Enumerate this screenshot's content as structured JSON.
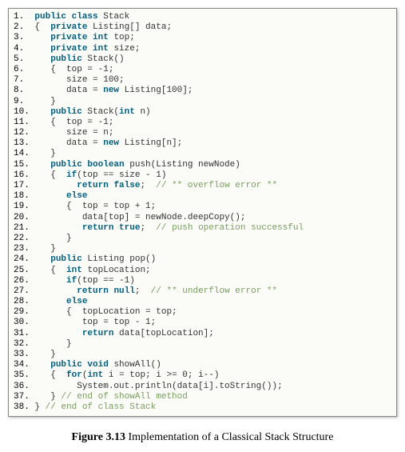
{
  "caption": {
    "label": "Figure 3.13",
    "text": " Implementation of a Classical Stack Structure"
  },
  "code": [
    {
      "n": "1.",
      "segs": [
        {
          "t": "  ",
          "c": "plain"
        },
        {
          "t": "public class",
          "c": "kw"
        },
        {
          "t": " Stack",
          "c": "plain"
        }
      ]
    },
    {
      "n": "2.",
      "segs": [
        {
          "t": "  {  ",
          "c": "plain"
        },
        {
          "t": "private",
          "c": "kw"
        },
        {
          "t": " Listing[] data;",
          "c": "plain"
        }
      ]
    },
    {
      "n": "3.",
      "segs": [
        {
          "t": "     ",
          "c": "plain"
        },
        {
          "t": "private int",
          "c": "kw"
        },
        {
          "t": " top;",
          "c": "plain"
        }
      ]
    },
    {
      "n": "4.",
      "segs": [
        {
          "t": "     ",
          "c": "plain"
        },
        {
          "t": "private int",
          "c": "kw"
        },
        {
          "t": " size;",
          "c": "plain"
        }
      ]
    },
    {
      "n": "5.",
      "segs": [
        {
          "t": "     ",
          "c": "plain"
        },
        {
          "t": "public",
          "c": "kw"
        },
        {
          "t": " Stack()",
          "c": "plain"
        }
      ]
    },
    {
      "n": "6.",
      "segs": [
        {
          "t": "     {  top = -1;",
          "c": "plain"
        }
      ]
    },
    {
      "n": "7.",
      "segs": [
        {
          "t": "        size = 100;",
          "c": "plain"
        }
      ]
    },
    {
      "n": "8.",
      "segs": [
        {
          "t": "        data = ",
          "c": "plain"
        },
        {
          "t": "new",
          "c": "kw"
        },
        {
          "t": " Listing[100];",
          "c": "plain"
        }
      ]
    },
    {
      "n": "9.",
      "segs": [
        {
          "t": "     }",
          "c": "plain"
        }
      ]
    },
    {
      "n": "10.",
      "segs": [
        {
          "t": "    ",
          "c": "plain"
        },
        {
          "t": "public",
          "c": "kw"
        },
        {
          "t": " Stack(",
          "c": "plain"
        },
        {
          "t": "int",
          "c": "kw"
        },
        {
          "t": " n)",
          "c": "plain"
        }
      ]
    },
    {
      "n": "11.",
      "segs": [
        {
          "t": "    {  top = -1;",
          "c": "plain"
        }
      ]
    },
    {
      "n": "12.",
      "segs": [
        {
          "t": "       size = n;",
          "c": "plain"
        }
      ]
    },
    {
      "n": "13.",
      "segs": [
        {
          "t": "       data = ",
          "c": "plain"
        },
        {
          "t": "new",
          "c": "kw"
        },
        {
          "t": " Listing[n];",
          "c": "plain"
        }
      ]
    },
    {
      "n": "14.",
      "segs": [
        {
          "t": "    }",
          "c": "plain"
        }
      ]
    },
    {
      "n": "15.",
      "segs": [
        {
          "t": "    ",
          "c": "plain"
        },
        {
          "t": "public boolean",
          "c": "kw"
        },
        {
          "t": " push(Listing newNode)",
          "c": "plain"
        }
      ]
    },
    {
      "n": "16.",
      "segs": [
        {
          "t": "    {  ",
          "c": "plain"
        },
        {
          "t": "if",
          "c": "kw"
        },
        {
          "t": "(top == size - 1)",
          "c": "plain"
        }
      ]
    },
    {
      "n": "17.",
      "segs": [
        {
          "t": "         ",
          "c": "plain"
        },
        {
          "t": "return false",
          "c": "kw"
        },
        {
          "t": ";  ",
          "c": "plain"
        },
        {
          "t": "// ** overflow error **",
          "c": "cmt"
        }
      ]
    },
    {
      "n": "18.",
      "segs": [
        {
          "t": "       ",
          "c": "plain"
        },
        {
          "t": "else",
          "c": "kw"
        }
      ]
    },
    {
      "n": "19.",
      "segs": [
        {
          "t": "       {  top = top + 1;",
          "c": "plain"
        }
      ]
    },
    {
      "n": "20.",
      "segs": [
        {
          "t": "          data[top] = newNode.deepCopy();",
          "c": "plain"
        }
      ]
    },
    {
      "n": "21.",
      "segs": [
        {
          "t": "          ",
          "c": "plain"
        },
        {
          "t": "return true",
          "c": "kw"
        },
        {
          "t": ";  ",
          "c": "plain"
        },
        {
          "t": "// push operation successful",
          "c": "cmt"
        }
      ]
    },
    {
      "n": "22.",
      "segs": [
        {
          "t": "       }",
          "c": "plain"
        }
      ]
    },
    {
      "n": "23.",
      "segs": [
        {
          "t": "    }",
          "c": "plain"
        }
      ]
    },
    {
      "n": "24.",
      "segs": [
        {
          "t": "    ",
          "c": "plain"
        },
        {
          "t": "public",
          "c": "kw"
        },
        {
          "t": " Listing pop()",
          "c": "plain"
        }
      ]
    },
    {
      "n": "25.",
      "segs": [
        {
          "t": "    {  ",
          "c": "plain"
        },
        {
          "t": "int",
          "c": "kw"
        },
        {
          "t": " topLocation;",
          "c": "plain"
        }
      ]
    },
    {
      "n": "26.",
      "segs": [
        {
          "t": "       ",
          "c": "plain"
        },
        {
          "t": "if",
          "c": "kw"
        },
        {
          "t": "(top == -1)",
          "c": "plain"
        }
      ]
    },
    {
      "n": "27.",
      "segs": [
        {
          "t": "         ",
          "c": "plain"
        },
        {
          "t": "return null",
          "c": "kw"
        },
        {
          "t": ";  ",
          "c": "plain"
        },
        {
          "t": "// ** underflow error **",
          "c": "cmt"
        }
      ]
    },
    {
      "n": "28.",
      "segs": [
        {
          "t": "       ",
          "c": "plain"
        },
        {
          "t": "else",
          "c": "kw"
        }
      ]
    },
    {
      "n": "29.",
      "segs": [
        {
          "t": "       {  topLocation = top;",
          "c": "plain"
        }
      ]
    },
    {
      "n": "30.",
      "segs": [
        {
          "t": "          top = top - 1;",
          "c": "plain"
        }
      ]
    },
    {
      "n": "31.",
      "segs": [
        {
          "t": "          ",
          "c": "plain"
        },
        {
          "t": "return",
          "c": "kw"
        },
        {
          "t": " data[topLocation];",
          "c": "plain"
        }
      ]
    },
    {
      "n": "32.",
      "segs": [
        {
          "t": "       }",
          "c": "plain"
        }
      ]
    },
    {
      "n": "33.",
      "segs": [
        {
          "t": "    }",
          "c": "plain"
        }
      ]
    },
    {
      "n": "34.",
      "segs": [
        {
          "t": "    ",
          "c": "plain"
        },
        {
          "t": "public void",
          "c": "kw"
        },
        {
          "t": " showAll()",
          "c": "plain"
        }
      ]
    },
    {
      "n": "35.",
      "segs": [
        {
          "t": "    {  ",
          "c": "plain"
        },
        {
          "t": "for",
          "c": "kw"
        },
        {
          "t": "(",
          "c": "plain"
        },
        {
          "t": "int",
          "c": "kw"
        },
        {
          "t": " i = top; i >= 0; i--)",
          "c": "plain"
        }
      ]
    },
    {
      "n": "36.",
      "segs": [
        {
          "t": "         System.out.println(data[i].toString());",
          "c": "plain"
        }
      ]
    },
    {
      "n": "37.",
      "segs": [
        {
          "t": "    } ",
          "c": "plain"
        },
        {
          "t": "// end of showAll method",
          "c": "cmt"
        }
      ]
    },
    {
      "n": "38.",
      "segs": [
        {
          "t": " } ",
          "c": "plain"
        },
        {
          "t": "// end of class Stack",
          "c": "cmt"
        }
      ]
    }
  ]
}
